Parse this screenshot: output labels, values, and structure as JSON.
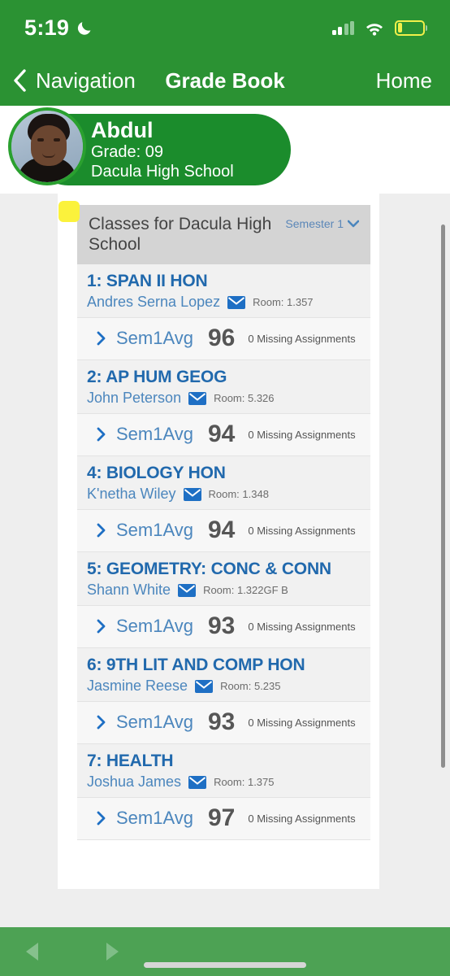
{
  "status_bar": {
    "time": "5:19",
    "dnd_icon": "crescent-moon-icon",
    "signal_icon": "cellular-signal-icon",
    "wifi_icon": "wifi-icon",
    "battery_icon": "battery-low-power-icon",
    "battery_color": "#f2f04a"
  },
  "nav_bar": {
    "back_label": "Navigation",
    "title": "Grade Book",
    "home_label": "Home",
    "background": "#2b9233"
  },
  "student": {
    "name": "Abdul",
    "grade": "Grade: 09",
    "school": "Dacula High School",
    "pill_color": "#1b8c2c"
  },
  "classes_panel": {
    "heading": "Classes for Dacula High School",
    "semester": "Semester 1",
    "highlight_color": "#fbf23c"
  },
  "classes": [
    {
      "name": "1: SPAN II HON",
      "teacher": "Andres Serna Lopez",
      "room": "Room: 1.357",
      "avg_label": "Sem1Avg",
      "score": "96",
      "missing": "0 Missing Assignments"
    },
    {
      "name": "2: AP HUM GEOG",
      "teacher": "John Peterson",
      "room": "Room: 5.326",
      "avg_label": "Sem1Avg",
      "score": "94",
      "missing": "0 Missing Assignments"
    },
    {
      "name": "4: BIOLOGY HON",
      "teacher": "K'netha Wiley",
      "room": "Room: 1.348",
      "avg_label": "Sem1Avg",
      "score": "94",
      "missing": "0 Missing Assignments"
    },
    {
      "name": "5: GEOMETRY: CONC & CONN",
      "teacher": "Shann White",
      "room": "Room: 1.322GF B",
      "avg_label": "Sem1Avg",
      "score": "93",
      "missing": "0 Missing Assignments"
    },
    {
      "name": "6: 9TH LIT AND COMP HON",
      "teacher": "Jasmine Reese",
      "room": "Room: 5.235",
      "avg_label": "Sem1Avg",
      "score": "93",
      "missing": "0 Missing Assignments"
    },
    {
      "name": "7: HEALTH",
      "teacher": "Joshua James",
      "room": "Room: 1.375",
      "avg_label": "Sem1Avg",
      "score": "97",
      "missing": "0 Missing Assignments"
    }
  ],
  "bottom_bar": {
    "back_icon": "triangle-back-icon",
    "forward_icon": "triangle-forward-icon",
    "home_indicator": "home-indicator-bar",
    "background": "#4da254"
  }
}
